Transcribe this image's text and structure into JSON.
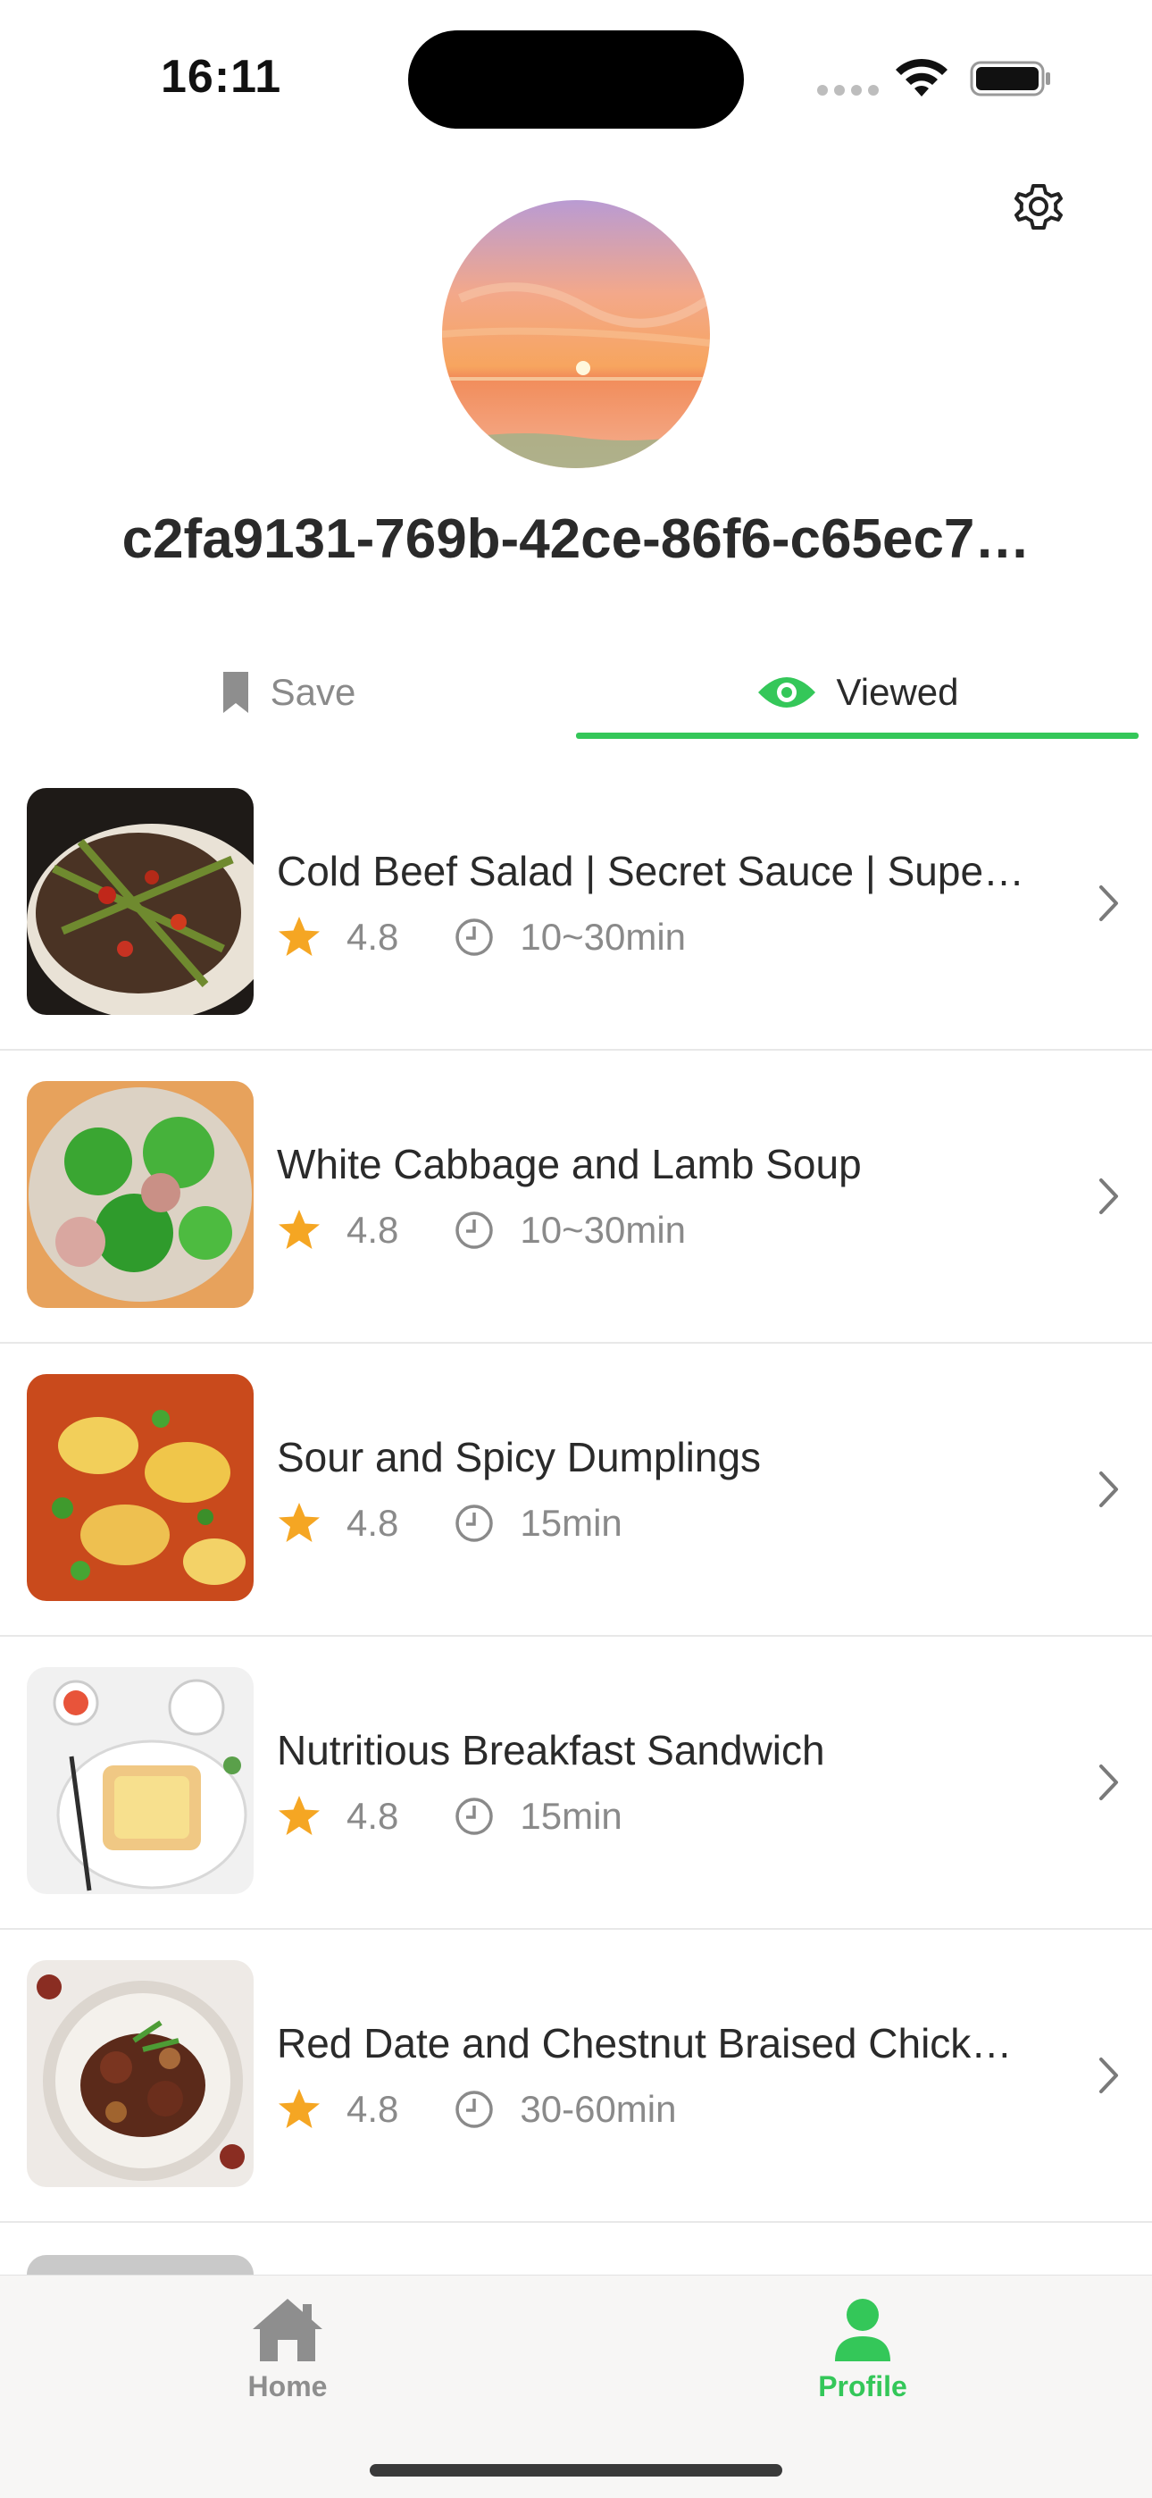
{
  "status_bar": {
    "time": "16:11"
  },
  "profile": {
    "username": "c2fa9131-769b-42ce-86f6-c65ec7…"
  },
  "tabs": [
    {
      "label": "Save",
      "icon": "bookmark-icon",
      "selected": false
    },
    {
      "label": "Viewed",
      "icon": "eye-icon",
      "selected": true
    }
  ],
  "recipes": [
    {
      "title": "Cold Beef Salad | Secret Sauce | Supe…",
      "rating": "4.8",
      "time": "10~30min"
    },
    {
      "title": "White Cabbage and Lamb Soup",
      "rating": "4.8",
      "time": "10~30min"
    },
    {
      "title": "Sour and Spicy Dumplings",
      "rating": "4.8",
      "time": "15min"
    },
    {
      "title": "Nutritious Breakfast Sandwich",
      "rating": "4.8",
      "time": "15min"
    },
    {
      "title": "Red Date and Chestnut Braised Chick…",
      "rating": "4.8",
      "time": "30-60min"
    }
  ],
  "tab_bar": {
    "home_label": "Home",
    "profile_label": "Profile",
    "active": "Profile"
  },
  "colors": {
    "accent": "#34c759",
    "star": "#f5a623",
    "muted": "#8a8a8a"
  }
}
